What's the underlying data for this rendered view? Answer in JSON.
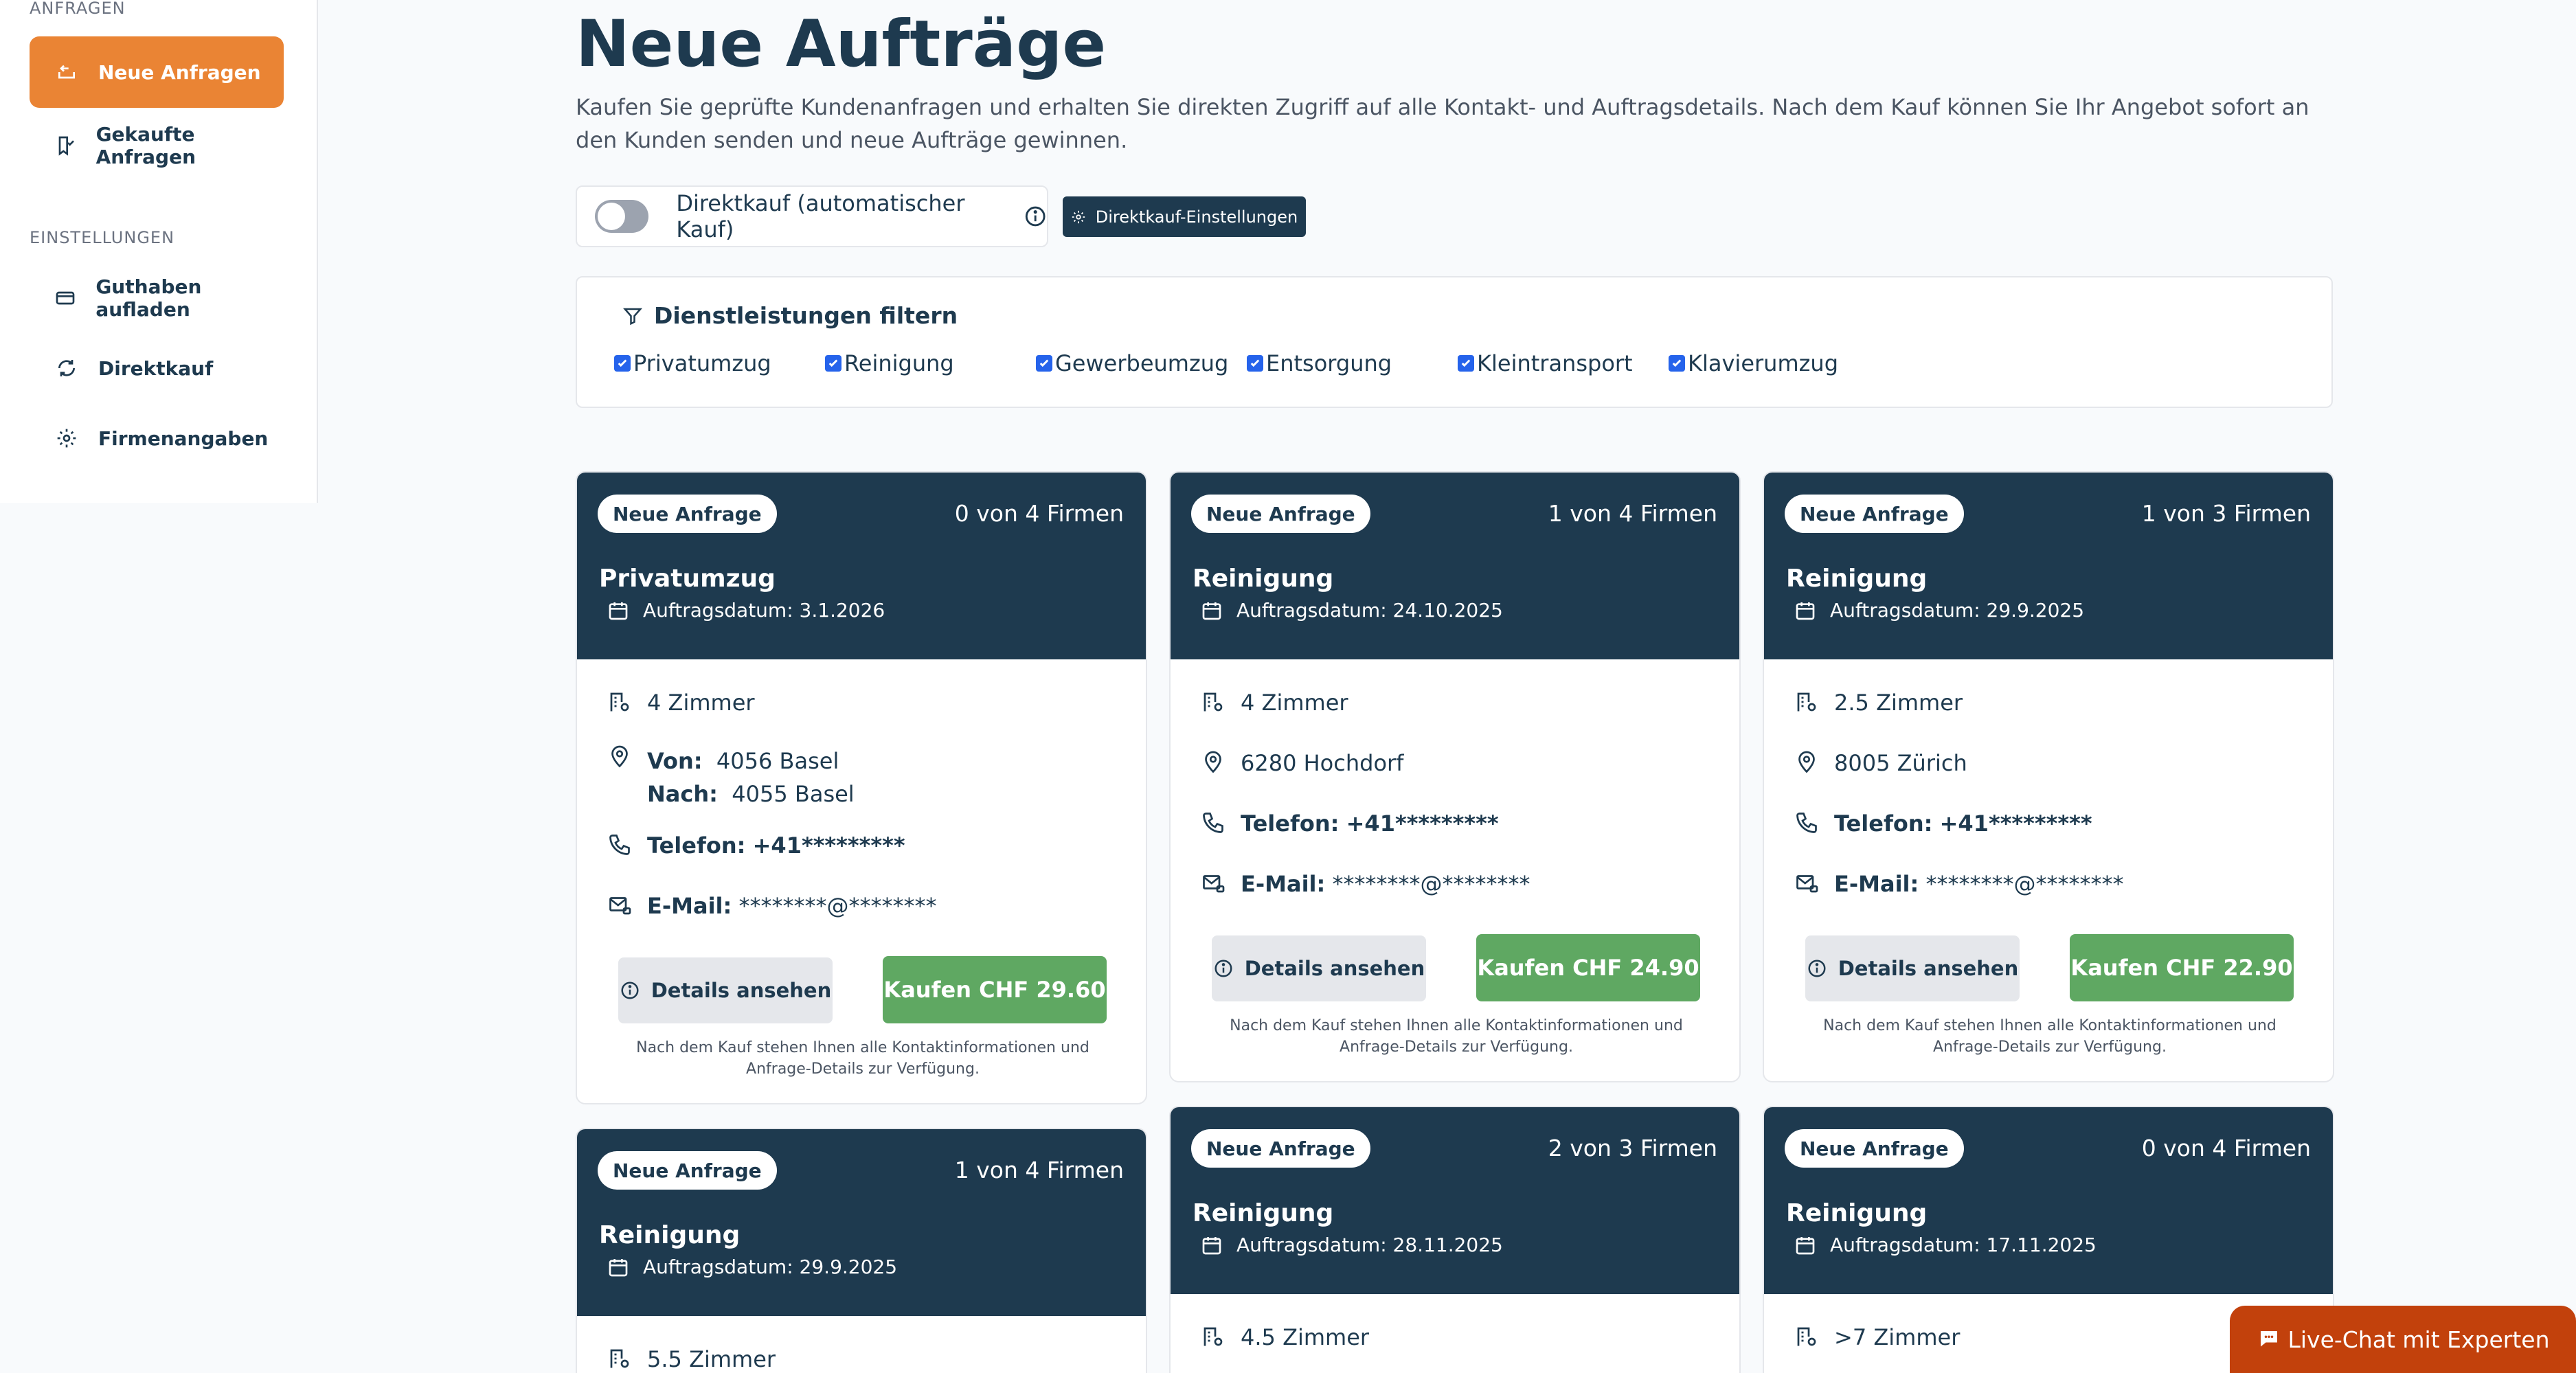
{
  "sidebar": {
    "section_requests": "ANFRAGEN",
    "items_requests": [
      {
        "label": "Neue Anfragen",
        "icon": "inbox-arrow-icon",
        "active": true
      },
      {
        "label": "Gekaufte Anfragen",
        "icon": "bookmark-check-icon",
        "active": false
      }
    ],
    "section_settings": "EINSTELLUNGEN",
    "items_settings": [
      {
        "label": "Guthaben aufladen",
        "icon": "credit-card-icon"
      },
      {
        "label": "Direktkauf",
        "icon": "refresh-icon"
      },
      {
        "label": "Firmenangaben",
        "icon": "gear-icon"
      }
    ]
  },
  "main": {
    "title": "Neue Aufträge",
    "subtitle": "Kaufen Sie geprüfte Kundenanfragen und erhalten Sie direkten Zugriff auf alle Kontakt- und Auftragsdetails. Nach dem Kauf können Sie Ihr Angebot sofort an den Kunden senden und neue Aufträge gewinnen.",
    "direct_buy_label": "Direktkauf (automatischer Kauf)",
    "direct_buy_enabled": false,
    "direct_buy_settings_label": "Direktkauf-Einstellungen",
    "filter_title": "Dienstleistungen filtern",
    "filters": [
      {
        "label": "Privatumzug",
        "checked": true
      },
      {
        "label": "Reinigung",
        "checked": true
      },
      {
        "label": "Gewerbeumzug",
        "checked": true
      },
      {
        "label": "Entsorgung",
        "checked": true
      },
      {
        "label": "Kleintransport",
        "checked": true
      },
      {
        "label": "Klavierumzug",
        "checked": true
      }
    ]
  },
  "cards": [
    {
      "badge": "Neue Anfrage",
      "firms": "0 von 4 Firmen",
      "service": "Privatumzug",
      "date": "Auftragsdatum: 3.1.2026",
      "rooms": "4 Zimmer",
      "from_label": "Von:",
      "from": "4056 Basel",
      "to_label": "Nach:",
      "to": "4055 Basel",
      "phone_label": "Telefon:",
      "phone": "+41*********",
      "email_label": "E-Mail:",
      "email": "********@********",
      "details_label": "Details ansehen",
      "buy_label": "Kaufen CHF 29.60",
      "note": "Nach dem Kauf stehen Ihnen alle Kontaktinformationen und Anfrage-Details zur Verfügung."
    },
    {
      "badge": "Neue Anfrage",
      "firms": "1 von 4 Firmen",
      "service": "Reinigung",
      "date": "Auftragsdatum: 24.10.2025",
      "rooms": "4 Zimmer",
      "location": "6280 Hochdorf",
      "phone_label": "Telefon:",
      "phone": "+41*********",
      "email_label": "E-Mail:",
      "email": "********@********",
      "details_label": "Details ansehen",
      "buy_label": "Kaufen CHF 24.90",
      "note": "Nach dem Kauf stehen Ihnen alle Kontaktinformationen und Anfrage-Details zur Verfügung."
    },
    {
      "badge": "Neue Anfrage",
      "firms": "1 von 3 Firmen",
      "service": "Reinigung",
      "date": "Auftragsdatum: 29.9.2025",
      "rooms": "2.5 Zimmer",
      "location": "8005 Zürich",
      "phone_label": "Telefon:",
      "phone": "+41*********",
      "email_label": "E-Mail:",
      "email": "********@********",
      "details_label": "Details ansehen",
      "buy_label": "Kaufen CHF 22.90",
      "note": "Nach dem Kauf stehen Ihnen alle Kontaktinformationen und Anfrage-Details zur Verfügung."
    },
    {
      "badge": "Neue Anfrage",
      "firms": "1 von 4 Firmen",
      "service": "Reinigung",
      "date": "Auftragsdatum: 29.9.2025",
      "rooms": "5.5 Zimmer"
    },
    {
      "badge": "Neue Anfrage",
      "firms": "2 von 3 Firmen",
      "service": "Reinigung",
      "date": "Auftragsdatum: 28.11.2025",
      "rooms": "4.5 Zimmer"
    },
    {
      "badge": "Neue Anfrage",
      "firms": "0 von 4 Firmen",
      "service": "Reinigung",
      "date": "Auftragsdatum: 17.11.2025",
      "rooms": ">7 Zimmer"
    }
  ],
  "livechat_label": "Live-Chat mit Experten",
  "colors": {
    "accent": "#ea8434",
    "navy": "#1e3a4f",
    "buy": "#5fa862",
    "livechat": "#c2410c"
  }
}
